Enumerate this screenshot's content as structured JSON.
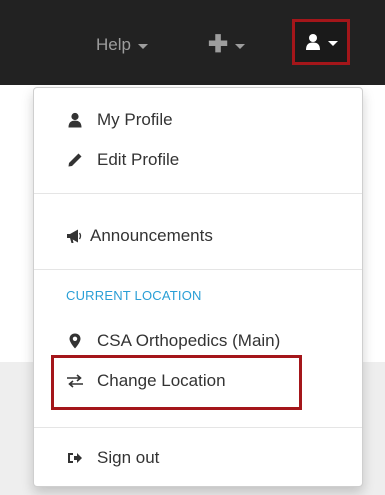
{
  "navbar": {
    "help_label": "Help",
    "add_icon": "plus-icon",
    "user_icon": "user-icon"
  },
  "menu": {
    "my_profile": "My Profile",
    "edit_profile": "Edit Profile",
    "announcements": "Announcements",
    "current_location_header": "CURRENT LOCATION",
    "current_location_value": "CSA Orthopedics (Main)",
    "change_location": "Change Location",
    "sign_out": "Sign out"
  },
  "colors": {
    "navbar_bg": "#222222",
    "highlight": "#a4161a",
    "header": "#2a9fd6"
  }
}
